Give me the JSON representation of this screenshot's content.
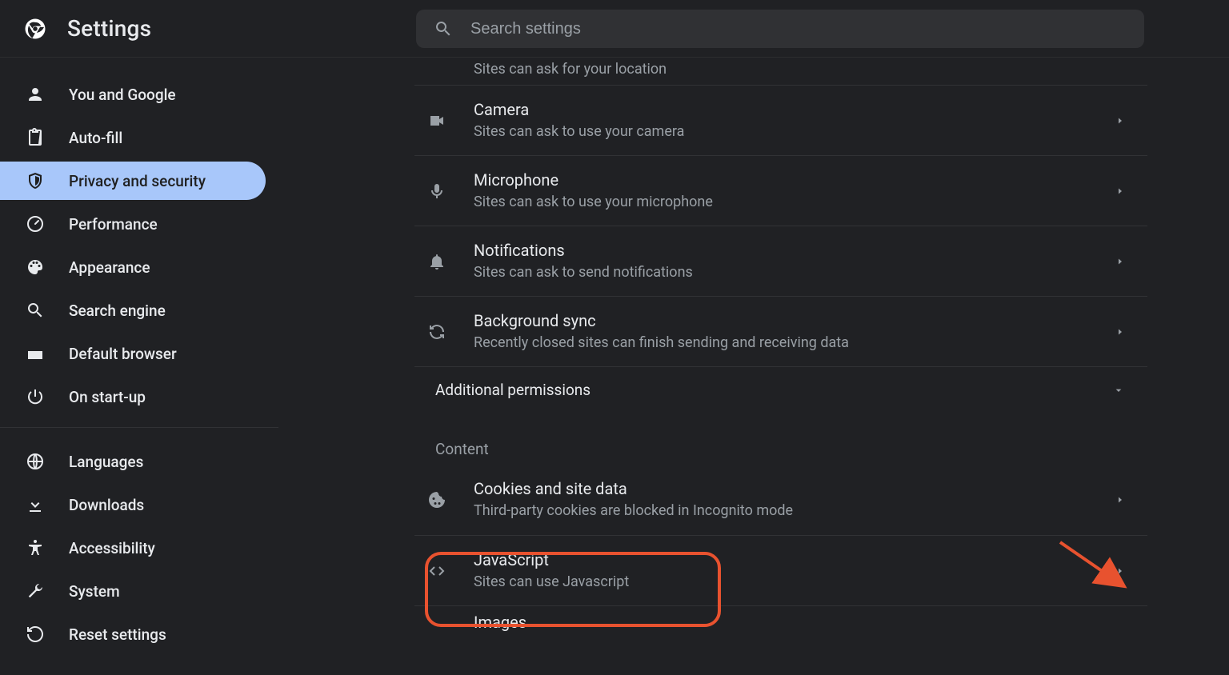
{
  "header": {
    "title": "Settings",
    "search_placeholder": "Search settings"
  },
  "sidebar": {
    "items": [
      {
        "label": "You and Google",
        "icon": "person-icon"
      },
      {
        "label": "Auto-fill",
        "icon": "clipboard-icon"
      },
      {
        "label": "Privacy and security",
        "icon": "shield-icon",
        "active": true
      },
      {
        "label": "Performance",
        "icon": "gauge-icon"
      },
      {
        "label": "Appearance",
        "icon": "palette-icon"
      },
      {
        "label": "Search engine",
        "icon": "search-icon"
      },
      {
        "label": "Default browser",
        "icon": "browser-icon"
      },
      {
        "label": "On start-up",
        "icon": "power-icon"
      }
    ],
    "items2": [
      {
        "label": "Languages",
        "icon": "globe-icon"
      },
      {
        "label": "Downloads",
        "icon": "download-icon"
      },
      {
        "label": "Accessibility",
        "icon": "accessibility-icon"
      },
      {
        "label": "System",
        "icon": "wrench-icon"
      },
      {
        "label": "Reset settings",
        "icon": "reset-icon"
      }
    ]
  },
  "permissions": {
    "partial_location_sub": "Sites can ask for your location",
    "rows": [
      {
        "title": "Camera",
        "sub": "Sites can ask to use your camera",
        "icon": "camera-icon"
      },
      {
        "title": "Microphone",
        "sub": "Sites can ask to use your microphone",
        "icon": "microphone-icon"
      },
      {
        "title": "Notifications",
        "sub": "Sites can ask to send notifications",
        "icon": "bell-icon"
      },
      {
        "title": "Background sync",
        "sub": "Recently closed sites can finish sending and receiving data",
        "icon": "sync-icon"
      }
    ],
    "expander_label": "Additional permissions"
  },
  "content_section": {
    "heading": "Content",
    "rows": [
      {
        "title": "Cookies and site data",
        "sub": "Third-party cookies are blocked in Incognito mode",
        "icon": "cookie-icon"
      },
      {
        "title": "JavaScript",
        "sub": "Sites can use Javascript",
        "icon": "code-icon",
        "highlighted": true
      },
      {
        "title": "Images",
        "sub": "",
        "icon": "image-icon"
      }
    ]
  },
  "annotation": {
    "highlight_color": "#e8522f"
  }
}
